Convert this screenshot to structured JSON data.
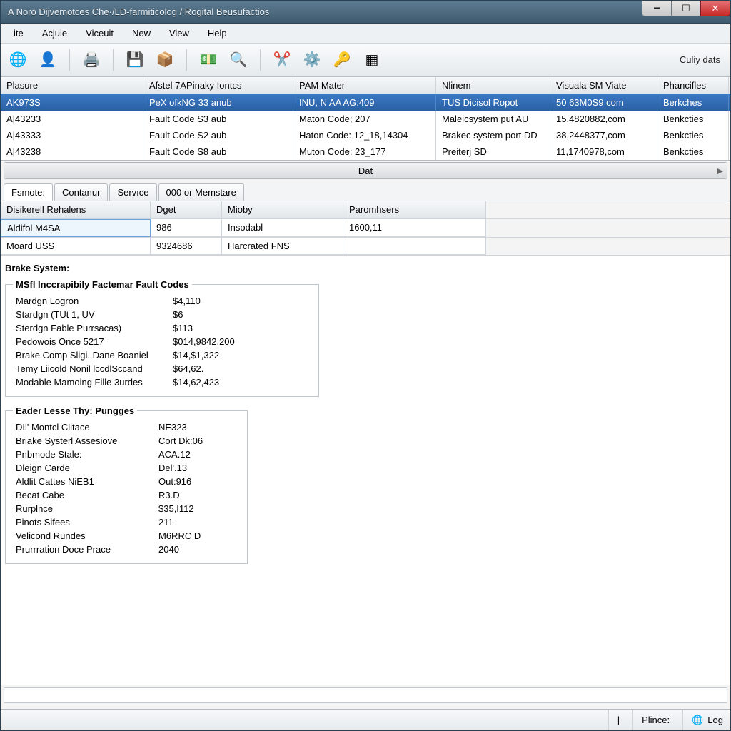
{
  "window_title": "A Noro Dijvemotces Che·/LD-farmiticolog / Rogital Beusufactios",
  "menus": [
    "ite",
    "Acjule",
    "Viceuit",
    "New",
    "View",
    "Help"
  ],
  "toolbar_right": "Culiy dats",
  "cols": [
    "Plasure",
    "Afstel 7APinaky Iontcs",
    "PAM Mater",
    "Nlinem",
    "Visuala SM Viate",
    "Phancifles"
  ],
  "rows": [
    [
      "AK973S",
      "PeX ofkNG 33 anub",
      "INU, N AA AG:409",
      "TUS Dicisol Ropot",
      "50 63M0S9 com",
      "Berkches"
    ],
    [
      "A|43233",
      "Fault Code S3 aub",
      "Maton Code; 207",
      "Maleicsystem put AU",
      "15,4820882,com",
      "Benkcties"
    ],
    [
      "A|43333",
      "Fault Code S2 aub",
      "Haton Code: 12_18,14304",
      "Brakec system port DD",
      "38,2448377,com",
      "Benkcties"
    ],
    [
      "A|43238",
      "Fault Code S8 aub",
      "Muton Code: 23_177",
      "Preiterj SD",
      "11,1740978,com",
      "Benkcties"
    ]
  ],
  "datbar_label": "Dat",
  "tabs": [
    "Fsmote:",
    "Contanur",
    "Servıce",
    "000 or Memstare"
  ],
  "sub_cols": [
    "Disikerell Rehalens",
    "Dget",
    "Mioby",
    "Paromhsers"
  ],
  "sub_rows": [
    [
      "Aldifol M4SA",
      "986",
      "Insodabl",
      "1600,11"
    ],
    [
      "Moard USS",
      "9324686",
      "Harcrated FNS",
      ""
    ]
  ],
  "brake_title": "Brake System:",
  "group1": {
    "legend": "MSfl Inccrapibily Factemar Fault Codes",
    "rows": [
      [
        "Mardgn Logron",
        "$4,110"
      ],
      [
        "Stardgn (TUt 1, UV",
        "$6"
      ],
      [
        "Sterdgn Fable Purrsacas)",
        "$113"
      ],
      [
        "Pedowois Once 5217",
        "$014,9842,200"
      ],
      [
        "Brake Comp Sligi. Dane Boaniel",
        "$14,$1,322"
      ],
      [
        "Temy Liicold Nonil lccdlSccand",
        "$64,62."
      ],
      [
        "Modable Mamoing Fille 3urdes",
        "$14,62,423"
      ]
    ]
  },
  "group2": {
    "legend": "Eader Lesse Thy: Pungges",
    "rows": [
      [
        "DIl' Montcl Ciitace",
        "NE323"
      ],
      [
        "Briake Systerl Assesiove",
        "Cort Dk:06"
      ],
      [
        "Pnbmode Stale:",
        "ACA.12"
      ],
      [
        "Dleign Carde",
        "Del'.13"
      ],
      [
        "Aldlit Cattes NiEB1",
        "Out:916"
      ],
      [
        "Becat Cabe",
        "R3.D"
      ],
      [
        "Rurplnce",
        "$35,I112"
      ],
      [
        "Pinots Sifees",
        "211"
      ],
      [
        "Velicond Rundes",
        "M6RRC D"
      ],
      [
        "Prurrration Doce Prace",
        "2040"
      ]
    ]
  },
  "status": {
    "plince": "Plince:",
    "log": "Log"
  },
  "icons": {
    "globe": "🌐",
    "user": "👤",
    "printer": "🖨️",
    "save": "💾",
    "box": "📦",
    "money": "💵",
    "search": "🔍",
    "scissors": "✂️",
    "gear": "⚙️",
    "key": "🔑",
    "grid": "▦"
  }
}
